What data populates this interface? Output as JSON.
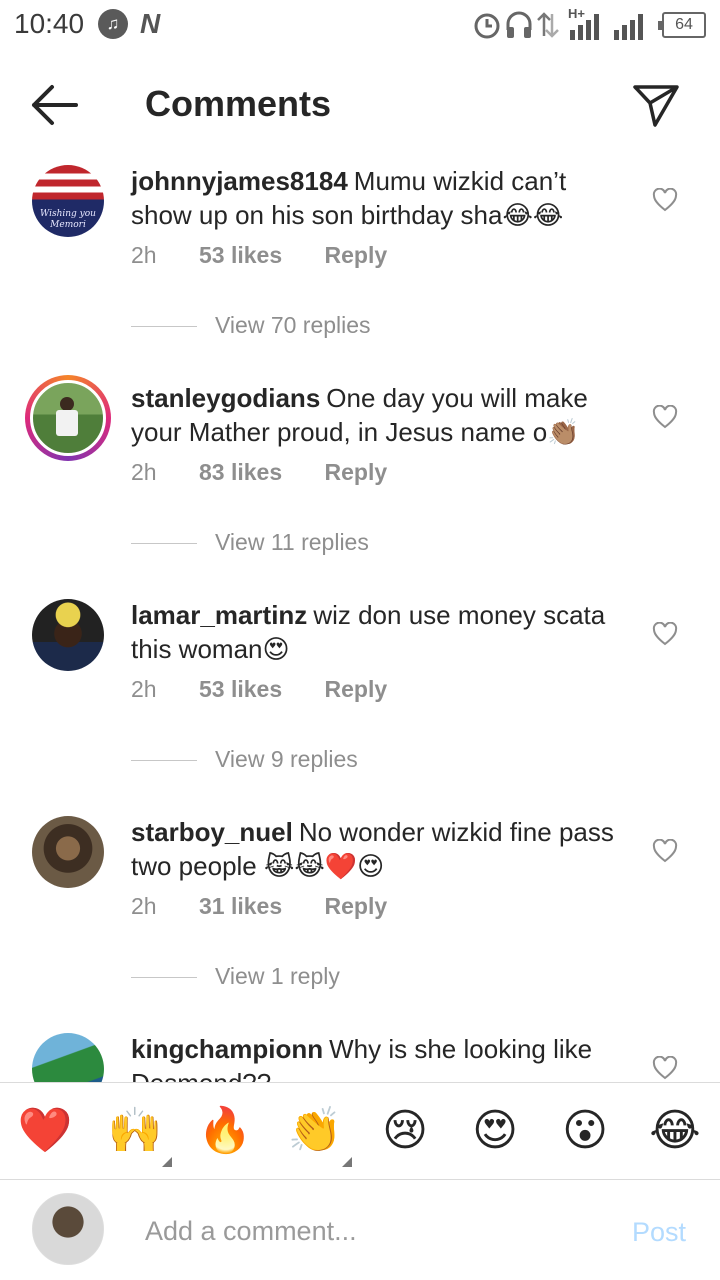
{
  "status_bar": {
    "time": "10:40",
    "music_icon": "music-note-icon",
    "n_icon": "N",
    "network": "H+",
    "battery": "64"
  },
  "header": {
    "title": "Comments"
  },
  "comments": [
    {
      "username": "johnnyjames8184",
      "text": "Mumu wizkid can’t show up on his son birthday sha😂😂",
      "time": "2h",
      "likes": "53 likes",
      "reply": "Reply",
      "view_replies": "View 70 replies",
      "avatar_text": "Wishing you Memori"
    },
    {
      "username": "stanleygodians",
      "text": "One day you will make your Mather proud, in Jesus name o👏🏽",
      "time": "2h",
      "likes": "83 likes",
      "reply": "Reply",
      "view_replies": "View 11 replies"
    },
    {
      "username": "lamar_martinz",
      "text": "wiz don use money scata this woman😍",
      "time": "2h",
      "likes": "53 likes",
      "reply": "Reply",
      "view_replies": "View 9 replies"
    },
    {
      "username": "starboy_nuel",
      "text": "No wonder wizkid fine pass two people 😹😹❤️😍",
      "time": "2h",
      "likes": "31 likes",
      "reply": "Reply",
      "view_replies": "View 1 reply"
    },
    {
      "username": "kingchampionn",
      "text": "Why is she looking like Desmond??"
    }
  ],
  "reactions": [
    "❤️",
    "🙌",
    "🔥",
    "👏",
    "😢",
    "😍",
    "😮",
    "😂"
  ],
  "composer": {
    "placeholder": "Add a comment...",
    "post_label": "Post"
  },
  "colors": {
    "text": "#262626",
    "muted": "#8e8e8e",
    "post_disabled": "#b3dbff",
    "heart_red": "#ed4956"
  }
}
